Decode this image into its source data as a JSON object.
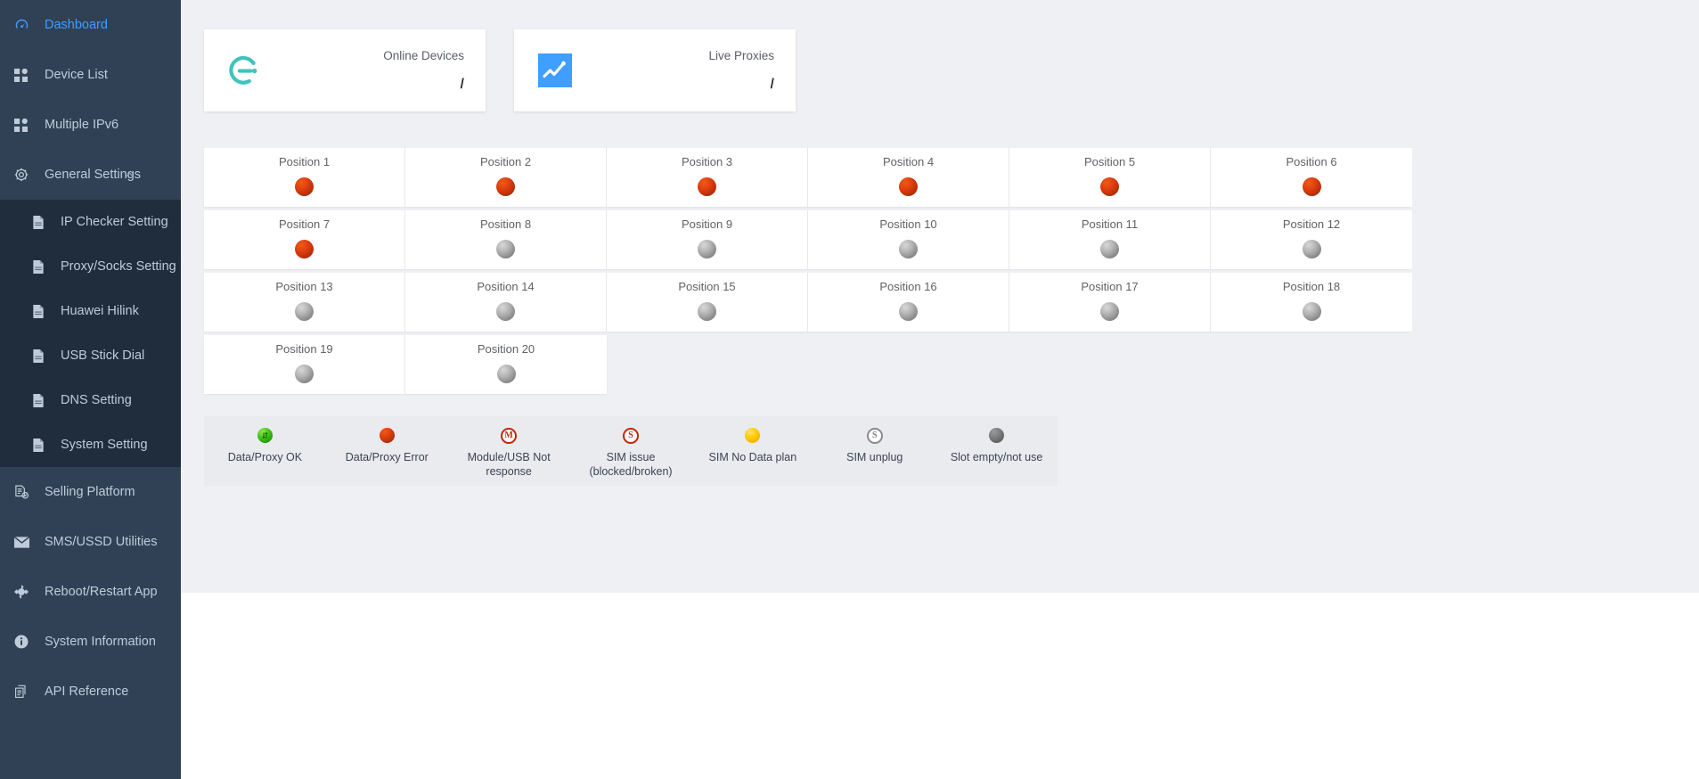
{
  "sidebar": {
    "items": [
      {
        "label": "Dashboard",
        "icon": "dashboard-icon",
        "active": true
      },
      {
        "label": "Device List",
        "icon": "grid-icon",
        "active": false
      },
      {
        "label": "Multiple IPv6",
        "icon": "grid-icon",
        "active": false
      },
      {
        "label": "General Settings",
        "icon": "gear-icon",
        "active": false,
        "expanded": true
      }
    ],
    "submenu": [
      {
        "label": "IP Checker Setting",
        "icon": "document-icon"
      },
      {
        "label": "Proxy/Socks Setting",
        "icon": "document-icon"
      },
      {
        "label": "Huawei Hilink",
        "icon": "document-icon"
      },
      {
        "label": "USB Stick Dial",
        "icon": "document-icon"
      },
      {
        "label": "DNS Setting",
        "icon": "document-icon"
      },
      {
        "label": "System Setting",
        "icon": "document-icon"
      }
    ],
    "items_after": [
      {
        "label": "Selling Platform",
        "icon": "document-check-icon"
      },
      {
        "label": "SMS/USSD Utilities",
        "icon": "envelope-icon"
      },
      {
        "label": "Reboot/Restart App",
        "icon": "refresh-icon"
      },
      {
        "label": "System Information",
        "icon": "info-icon"
      },
      {
        "label": "API Reference",
        "icon": "copy-icon"
      }
    ],
    "accent_color": "#409eff",
    "background_color": "#304156",
    "submenu_background_color": "#1f2d3d"
  },
  "stats": [
    {
      "title": "Online Devices",
      "value": "/",
      "icon": "e-logo-icon",
      "icon_color": "#42c2bd"
    },
    {
      "title": "Live Proxies",
      "value": "/",
      "icon": "trend-chart-icon",
      "icon_color": "#409eff"
    }
  ],
  "positions": [
    {
      "label": "Position 1",
      "status": "red"
    },
    {
      "label": "Position 2",
      "status": "red"
    },
    {
      "label": "Position 3",
      "status": "red"
    },
    {
      "label": "Position 4",
      "status": "red"
    },
    {
      "label": "Position 5",
      "status": "red"
    },
    {
      "label": "Position 6",
      "status": "red"
    },
    {
      "label": "Position 7",
      "status": "red"
    },
    {
      "label": "Position 8",
      "status": "gray"
    },
    {
      "label": "Position 9",
      "status": "gray"
    },
    {
      "label": "Position 10",
      "status": "gray"
    },
    {
      "label": "Position 11",
      "status": "gray"
    },
    {
      "label": "Position 12",
      "status": "gray"
    },
    {
      "label": "Position 13",
      "status": "gray"
    },
    {
      "label": "Position 14",
      "status": "gray"
    },
    {
      "label": "Position 15",
      "status": "gray"
    },
    {
      "label": "Position 16",
      "status": "gray"
    },
    {
      "label": "Position 17",
      "status": "gray"
    },
    {
      "label": "Position 18",
      "status": "gray"
    },
    {
      "label": "Position 19",
      "status": "gray"
    },
    {
      "label": "Position 20",
      "status": "gray"
    }
  ],
  "legend": [
    {
      "label": "Data/Proxy OK",
      "icon": "green-arrows-orb-icon"
    },
    {
      "label": "Data/Proxy Error",
      "icon": "red-orb-icon"
    },
    {
      "label": "Module/USB Not response",
      "icon": "m-ring-icon"
    },
    {
      "label": "SIM issue (blocked/broken)",
      "icon": "s-ring-red-icon"
    },
    {
      "label": "SIM No Data plan",
      "icon": "yellow-orb-icon"
    },
    {
      "label": "SIM unplug",
      "icon": "s-ring-gray-icon"
    },
    {
      "label": "Slot empty/not use",
      "icon": "gray-orb-icon"
    }
  ],
  "colors": {
    "page_background": "#eff0f4",
    "legend_background": "#eaebef",
    "card_background": "#ffffff",
    "status_red": "#cc3300",
    "status_gray": "#8a8a8a",
    "status_green": "#2eb20a",
    "status_yellow": "#ffcc00"
  }
}
